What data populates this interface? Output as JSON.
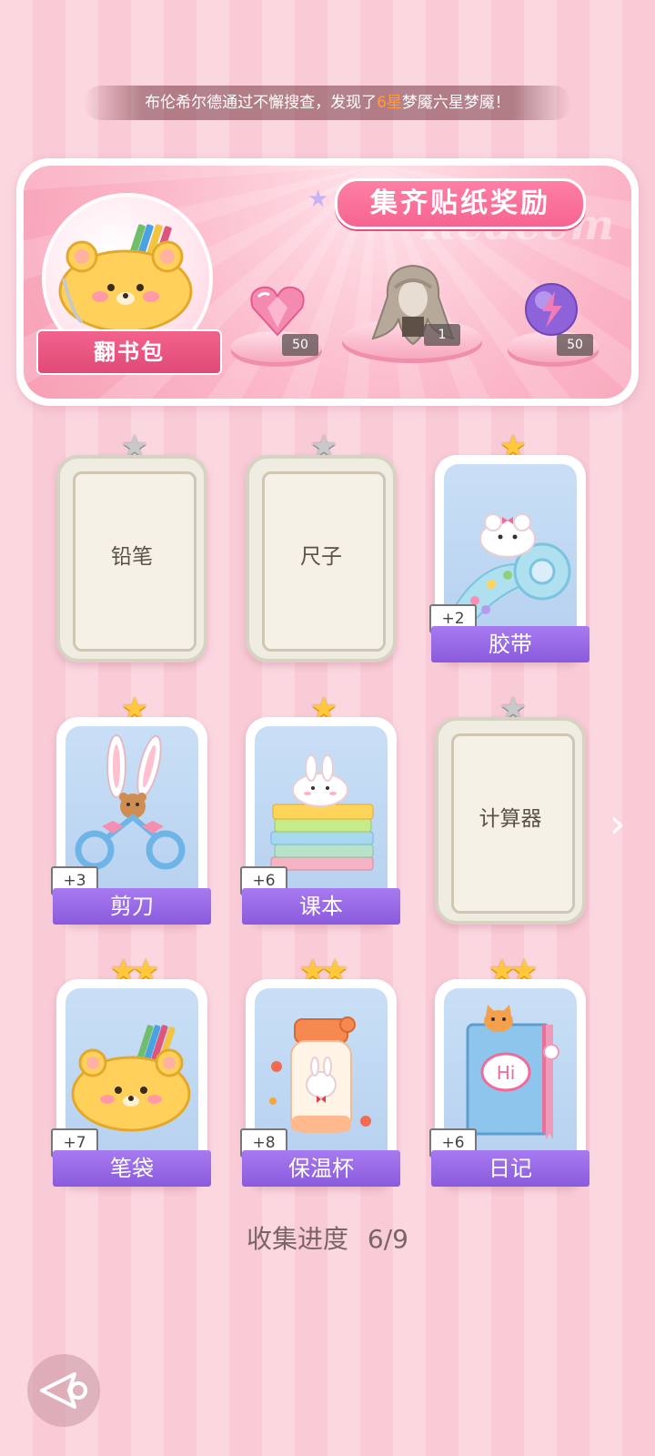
{
  "ticker": {
    "prefix": "布伦希尔德通过不懈搜查，发现了",
    "highlight": "6星",
    "suffix": "梦魇六星梦魇！"
  },
  "banner": {
    "title": "集齐贴纸奖励",
    "watermark": "Redeem",
    "flip_label": "翻书包",
    "rewards": [
      {
        "icon": "heart-gem-icon",
        "count": "50"
      },
      {
        "icon": "hairstyle-icon",
        "count": "1"
      },
      {
        "icon": "energy-orb-icon",
        "count": "50"
      }
    ]
  },
  "cards": [
    {
      "name": "铅笔",
      "locked": true,
      "stars": 1
    },
    {
      "name": "尺子",
      "locked": true,
      "stars": 1
    },
    {
      "name": "胶带",
      "locked": false,
      "stars": 1,
      "plus": "+2",
      "icon": "tape-icon"
    },
    {
      "name": "剪刀",
      "locked": false,
      "stars": 1,
      "plus": "+3",
      "icon": "scissors-icon"
    },
    {
      "name": "课本",
      "locked": false,
      "stars": 1,
      "plus": "+6",
      "icon": "textbook-icon"
    },
    {
      "name": "计算器",
      "locked": true,
      "stars": 1
    },
    {
      "name": "笔袋",
      "locked": false,
      "stars": 2,
      "plus": "+7",
      "icon": "pencil-case-icon"
    },
    {
      "name": "保温杯",
      "locked": false,
      "stars": 2,
      "plus": "+8",
      "icon": "thermos-icon"
    },
    {
      "name": "日记",
      "locked": false,
      "stars": 2,
      "plus": "+6",
      "icon": "diary-icon",
      "diary_text": "Hi"
    }
  ],
  "progress": {
    "label": "收集进度",
    "value": "6/9"
  },
  "colors": {
    "accent_pink": "#f56590",
    "ribbon_purple": "#8a5bdc",
    "gold_star": "#ffc93b"
  }
}
